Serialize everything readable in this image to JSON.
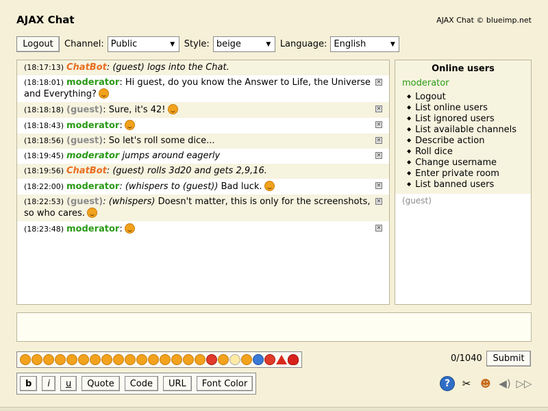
{
  "header": {
    "title": "AJAX Chat",
    "copyright": "AJAX Chat © blueimp.net"
  },
  "toolbar": {
    "logout": "Logout",
    "channel_label": "Channel:",
    "channel_value": "Public",
    "style_label": "Style:",
    "style_value": "beige",
    "language_label": "Language:",
    "language_value": "English"
  },
  "messages": [
    {
      "time": "(18:17:13)",
      "user": "ChatBot",
      "text": ": (guest) logs into the Chat."
    },
    {
      "time": "(18:18:01)",
      "user": "moderator",
      "text": ": Hi guest, do you know the Answer to Life, the Universe and Everything?"
    },
    {
      "time": "(18:18:18)",
      "user": "(guest)",
      "text": ": Sure, it's 42!"
    },
    {
      "time": "(18:18:43)",
      "user": "moderator",
      "text": ":"
    },
    {
      "time": "(18:18:56)",
      "user": "(guest)",
      "text": ": So let's roll some dice..."
    },
    {
      "time": "(18:19:45)",
      "user": "moderator",
      "text": " jumps around eagerly"
    },
    {
      "time": "(18:19:56)",
      "user": "ChatBot",
      "text": ": (guest) rolls 3d20 and gets 2,9,16."
    },
    {
      "time": "(18:22:00)",
      "user": "moderator",
      "whisper": ": (whispers to (guest))",
      "text": " Bad luck."
    },
    {
      "time": "(18:22:53)",
      "user": "(guest)",
      "whisper": ": (whispers)",
      "text": " Doesn't matter, this is only for the screenshots, so who cares."
    },
    {
      "time": "(18:23:48)",
      "user": "moderator",
      "text": ":"
    }
  ],
  "online": {
    "title": "Online users",
    "user1": "moderator",
    "menu": [
      "Logout",
      "List online users",
      "List ignored users",
      "List available channels",
      "Describe action",
      "Roll dice",
      "Change username",
      "Enter private room",
      "List banned users"
    ],
    "user2": "(guest)"
  },
  "input": {
    "counter": "0/1040",
    "submit": "Submit"
  },
  "format": {
    "bold": "b",
    "italic": "i",
    "underline": "u",
    "quote": "Quote",
    "code": "Code",
    "url": "URL",
    "color": "Font Color"
  },
  "icons": [
    "help-icon",
    "settings-icon",
    "online-users-icon",
    "sound-icon",
    "autoscroll-icon"
  ]
}
